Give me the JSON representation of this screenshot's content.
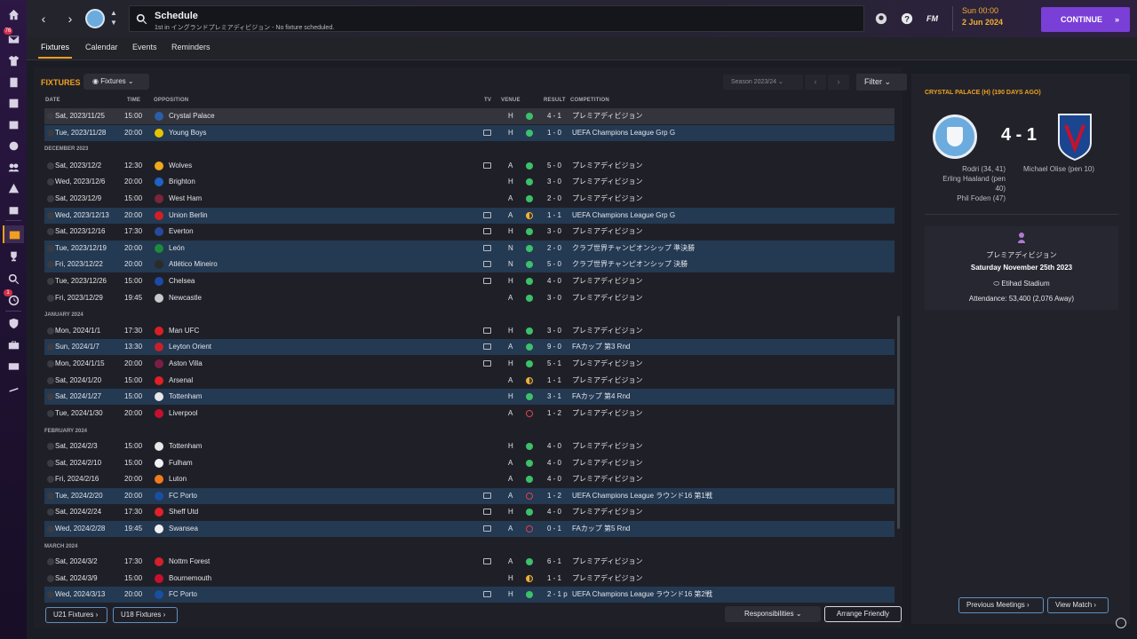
{
  "header": {
    "search_title": "Schedule",
    "search_subtitle": "1st in イングランドプレミアディビジョン - No fixture scheduled.",
    "fm_logo": "FM",
    "date_line1": "Sun 00:00",
    "date_line2": "2 Jun 2024",
    "continue_label": "CONTINUE",
    "continue_arrow": "»",
    "back_arrow": "‹",
    "forward_arrow": "›"
  },
  "sidebar": {
    "badges": {
      "inbox": "76",
      "dev": "1"
    }
  },
  "tabs": [
    {
      "label": "Fixtures",
      "active": true
    },
    {
      "label": "Calendar",
      "active": false
    },
    {
      "label": "Events",
      "active": false
    },
    {
      "label": "Reminders",
      "active": false
    }
  ],
  "fixtures": {
    "title": "FIXTURES",
    "view_dropdown": "Fixtures",
    "season_dropdown": "Season 2023/24",
    "filter_label": "Filter",
    "columns": {
      "date": "DATE",
      "time": "TIME",
      "opposition": "OPPOSITION",
      "tv": "TV",
      "venue": "VENUE",
      "result": "RESULT",
      "competition": "COMPETITION"
    },
    "sections": {
      "dec": "DECEMBER 2023",
      "jan": "JANUARY 2024",
      "feb": "FEBRUARY 2024",
      "mar": "MARCH 2024"
    },
    "rows": [
      {
        "date": "Sat, 2023/11/25",
        "time": "15:00",
        "opp": "Crystal Palace",
        "crest": "#2a5ea8",
        "tv": false,
        "venue": "H",
        "res": "W",
        "score": "4 - 1",
        "comp": "プレミアディビジョン",
        "style": "sel"
      },
      {
        "date": "Tue, 2023/11/28",
        "time": "20:00",
        "opp": "Young Boys",
        "crest": "#e6c300",
        "tv": true,
        "venue": "H",
        "res": "W",
        "score": "1 - 0",
        "comp": "UEFA Champions League Grp G",
        "style": "hl"
      },
      {
        "date": "Sat, 2023/12/2",
        "time": "12:30",
        "opp": "Wolves",
        "crest": "#f0a81c",
        "tv": true,
        "venue": "A",
        "res": "W",
        "score": "5 - 0",
        "comp": "プレミアディビジョン",
        "style": ""
      },
      {
        "date": "Wed, 2023/12/6",
        "time": "20:00",
        "opp": "Brighton",
        "crest": "#1e62c6",
        "tv": false,
        "venue": "H",
        "res": "W",
        "score": "3 - 0",
        "comp": "プレミアディビジョン",
        "style": ""
      },
      {
        "date": "Sat, 2023/12/9",
        "time": "15:00",
        "opp": "West Ham",
        "crest": "#7a263a",
        "tv": false,
        "venue": "A",
        "res": "W",
        "score": "2 - 0",
        "comp": "プレミアディビジョン",
        "style": ""
      },
      {
        "date": "Wed, 2023/12/13",
        "time": "20:00",
        "opp": "Union Berlin",
        "crest": "#d41f26",
        "tv": true,
        "venue": "A",
        "res": "D",
        "score": "1 - 1",
        "comp": "UEFA Champions League Grp G",
        "style": "hl"
      },
      {
        "date": "Sat, 2023/12/16",
        "time": "17:30",
        "opp": "Everton",
        "crest": "#274a9c",
        "tv": true,
        "venue": "H",
        "res": "W",
        "score": "3 - 0",
        "comp": "プレミアディビジョン",
        "style": ""
      },
      {
        "date": "Tue, 2023/12/19",
        "time": "20:00",
        "opp": "León",
        "crest": "#1b8a3c",
        "tv": true,
        "venue": "N",
        "res": "W",
        "score": "2 - 0",
        "comp": "クラブ世界チャンピオンシップ 準決勝",
        "style": "hl"
      },
      {
        "date": "Fri, 2023/12/22",
        "time": "20:00",
        "opp": "Atlético Mineiro",
        "crest": "#2b2b2b",
        "tv": true,
        "venue": "N",
        "res": "W",
        "score": "5 - 0",
        "comp": "クラブ世界チャンピオンシップ 決勝",
        "style": "hl"
      },
      {
        "date": "Tue, 2023/12/26",
        "time": "15:00",
        "opp": "Chelsea",
        "crest": "#1c4aa6",
        "tv": true,
        "venue": "H",
        "res": "W",
        "score": "4 - 0",
        "comp": "プレミアディビジョン",
        "style": ""
      },
      {
        "date": "Fri, 2023/12/29",
        "time": "19:45",
        "opp": "Newcastle",
        "crest": "#c8c8c8",
        "tv": false,
        "venue": "A",
        "res": "W",
        "score": "3 - 0",
        "comp": "プレミアディビジョン",
        "style": ""
      },
      {
        "date": "Mon, 2024/1/1",
        "time": "17:30",
        "opp": "Man UFC",
        "crest": "#d81f26",
        "tv": true,
        "venue": "H",
        "res": "W",
        "score": "3 - 0",
        "comp": "プレミアディビジョン",
        "style": ""
      },
      {
        "date": "Sun, 2024/1/7",
        "time": "13:30",
        "opp": "Leyton Orient",
        "crest": "#c8202a",
        "tv": true,
        "venue": "A",
        "res": "W",
        "score": "9 - 0",
        "comp": "FAカップ 第3 Rnd",
        "style": "hl"
      },
      {
        "date": "Mon, 2024/1/15",
        "time": "20:00",
        "opp": "Aston Villa",
        "crest": "#7b1e46",
        "tv": true,
        "venue": "H",
        "res": "W",
        "score": "5 - 1",
        "comp": "プレミアディビジョン",
        "style": ""
      },
      {
        "date": "Sat, 2024/1/20",
        "time": "15:00",
        "opp": "Arsenal",
        "crest": "#e01f26",
        "tv": false,
        "venue": "A",
        "res": "D",
        "score": "1 - 1",
        "comp": "プレミアディビジョン",
        "style": ""
      },
      {
        "date": "Sat, 2024/1/27",
        "time": "15:00",
        "opp": "Tottenham",
        "crest": "#e8e8e8",
        "tv": false,
        "venue": "H",
        "res": "W",
        "score": "3 - 1",
        "comp": "FAカップ 第4 Rnd",
        "style": "hl"
      },
      {
        "date": "Tue, 2024/1/30",
        "time": "20:00",
        "opp": "Liverpool",
        "crest": "#c8102e",
        "tv": false,
        "venue": "A",
        "res": "L",
        "score": "1 - 2",
        "comp": "プレミアディビジョン",
        "style": ""
      },
      {
        "date": "Sat, 2024/2/3",
        "time": "15:00",
        "opp": "Tottenham",
        "crest": "#e8e8e8",
        "tv": false,
        "venue": "H",
        "res": "W",
        "score": "4 - 0",
        "comp": "プレミアディビジョン",
        "style": ""
      },
      {
        "date": "Sat, 2024/2/10",
        "time": "15:00",
        "opp": "Fulham",
        "crest": "#f2f2f2",
        "tv": false,
        "venue": "A",
        "res": "W",
        "score": "4 - 0",
        "comp": "プレミアディビジョン",
        "style": ""
      },
      {
        "date": "Fri, 2024/2/16",
        "time": "20:00",
        "opp": "Luton",
        "crest": "#f07a1c",
        "tv": false,
        "venue": "A",
        "res": "W",
        "score": "4 - 0",
        "comp": "プレミアディビジョン",
        "style": ""
      },
      {
        "date": "Tue, 2024/2/20",
        "time": "20:00",
        "opp": "FC Porto",
        "crest": "#1a4fa0",
        "tv": true,
        "venue": "A",
        "res": "L",
        "score": "1 - 2",
        "comp": "UEFA Champions League ラウンド16 第1戦",
        "style": "hl"
      },
      {
        "date": "Sat, 2024/2/24",
        "time": "17:30",
        "opp": "Sheff Utd",
        "crest": "#e0202a",
        "tv": true,
        "venue": "H",
        "res": "W",
        "score": "4 - 0",
        "comp": "プレミアディビジョン",
        "style": ""
      },
      {
        "date": "Wed, 2024/2/28",
        "time": "19:45",
        "opp": "Swansea",
        "crest": "#f0f0f0",
        "tv": true,
        "venue": "A",
        "res": "L",
        "score": "0 - 1",
        "comp": "FAカップ 第5 Rnd",
        "style": "hl"
      },
      {
        "date": "Sat, 2024/3/2",
        "time": "17:30",
        "opp": "Nottm Forest",
        "crest": "#d4202a",
        "tv": true,
        "venue": "A",
        "res": "W",
        "score": "6 - 1",
        "comp": "プレミアディビジョン",
        "style": ""
      },
      {
        "date": "Sat, 2024/3/9",
        "time": "15:00",
        "opp": "Bournemouth",
        "crest": "#c8102e",
        "tv": false,
        "venue": "H",
        "res": "D",
        "score": "1 - 1",
        "comp": "プレミアディビジョン",
        "style": ""
      },
      {
        "date": "Wed, 2024/3/13",
        "time": "20:00",
        "opp": "FC Porto",
        "crest": "#1a4fa0",
        "tv": true,
        "venue": "H",
        "res": "W",
        "score": "2 - 1 p",
        "comp": "UEFA Champions League ラウンド16 第2戦",
        "style": "hl"
      }
    ]
  },
  "footer": {
    "u21": "U21 Fixtures",
    "u18": "U18 Fixtures",
    "responsibilities": "Responsibilities",
    "arrange_friendly": "Arrange Friendly"
  },
  "match_panel": {
    "title": "CRYSTAL PALACE (H) (190 DAYS AGO)",
    "score": "4 - 1",
    "home_scorers": [
      "Rodri (34, 41)",
      "Erling Haaland (pen",
      "40)",
      "Phil Foden (47)"
    ],
    "away_scorers": [
      "Michael Olise (pen 10)"
    ],
    "competition": "プレミアディビジョン",
    "date": "Saturday November 25th 2023",
    "stadium": "Etihad Stadium",
    "attendance": "Attendance: 53,400 (2,076 Away)",
    "prev_meetings": "Previous Meetings",
    "view_match": "View Match"
  },
  "colors": {
    "accent": "#f0a020",
    "continue": "#7a3fd6",
    "win": "#3cc06a",
    "draw": "#f0b030",
    "loss": "#e04050"
  }
}
